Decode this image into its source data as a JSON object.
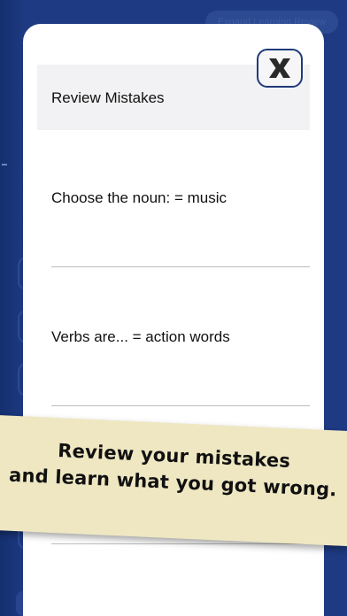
{
  "background": {
    "top_button_label": "Expand Learning Review"
  },
  "modal": {
    "title": "Review Mistakes",
    "close_label": "X",
    "items": [
      "Choose the noun: = music",
      "Verbs are... = action words"
    ]
  },
  "banner": {
    "line1": "Review your mistakes",
    "line2": "and learn what you got wrong."
  },
  "colors": {
    "background": "#1e3a82",
    "banner": "#efe7c2",
    "close_border": "#1f3a7a"
  }
}
